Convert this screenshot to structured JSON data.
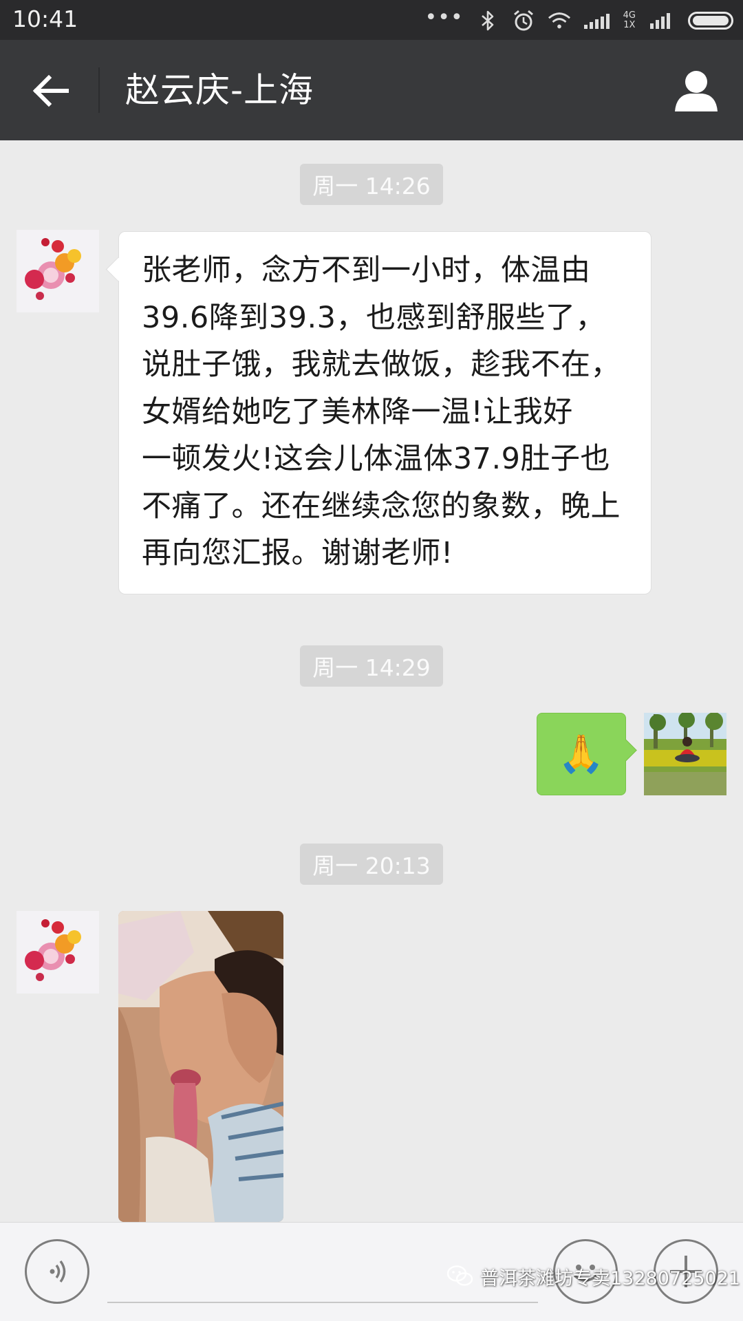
{
  "status_bar": {
    "time": "10:41",
    "dots": "•••",
    "network_top": "4G",
    "network_bottom": "1X"
  },
  "header": {
    "title": "赵云庆-上海",
    "back_icon": "arrow-left-icon",
    "profile_icon": "person-icon"
  },
  "messages": [
    {
      "type": "timestamp",
      "text": "周一 14:26"
    },
    {
      "type": "text",
      "side": "left",
      "lines": [
        "张老师，念方不到一小时，体温由",
        "39.6降到39.3，也感到舒服些了，",
        "说肚子饿，我就去做饭，趁我不在，",
        "女婿给她吃了美林降一温!让我好",
        "一顿发火!这会儿体温体37.9肚子也",
        "不痛了。还在继续念您的象数，晚上",
        "再向您汇报。谢谢老师!"
      ]
    },
    {
      "type": "timestamp",
      "text": "周一 14:29"
    },
    {
      "type": "emoji",
      "side": "right",
      "emoji": "🙏"
    },
    {
      "type": "timestamp",
      "text": "周一 20:13"
    },
    {
      "type": "image",
      "side": "left"
    }
  ],
  "input_bar": {
    "voice_icon": "voice-icon",
    "emoji_icon": "smiley-icon",
    "plus_icon": "plus-icon"
  },
  "watermark": {
    "text": "普洱茶滩坊专卖13280725021"
  },
  "colors": {
    "titlebar": "#38393b",
    "chat_bg": "#ebebeb",
    "sent_bubble": "#8ad55a",
    "received_bubble": "#ffffff"
  }
}
